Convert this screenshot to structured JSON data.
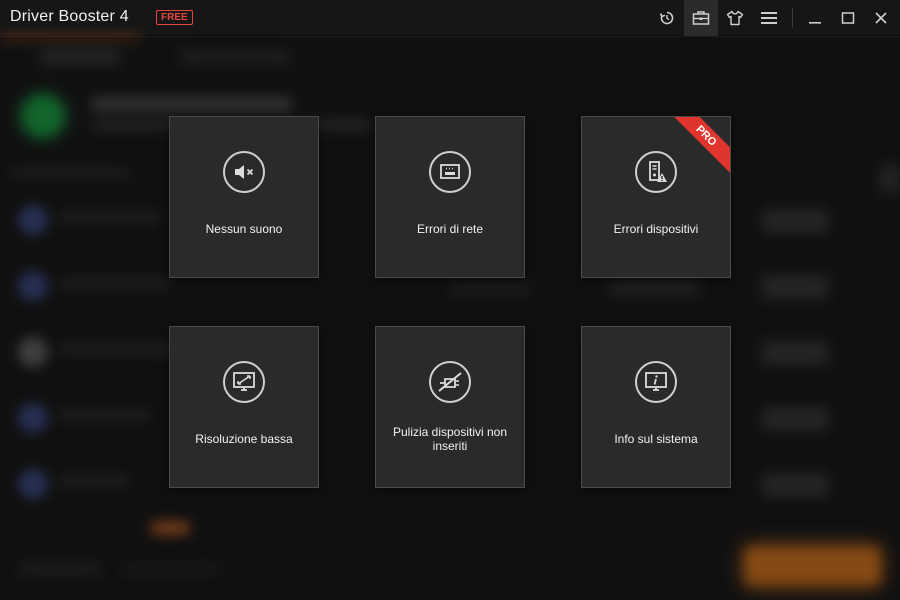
{
  "window": {
    "title": "Driver Booster 4",
    "badge": "FREE",
    "buttons": [
      {
        "name": "restore-icon"
      },
      {
        "name": "toolbox-icon"
      },
      {
        "name": "shirt-icon"
      },
      {
        "name": "menu-icon"
      },
      {
        "name": "minimize-icon"
      },
      {
        "name": "maximize-icon"
      },
      {
        "name": "close-icon"
      }
    ]
  },
  "tools": [
    {
      "label": "Nessun suono",
      "icon": "mute-speaker-icon"
    },
    {
      "label": "Errori di rete",
      "icon": "network-port-icon"
    },
    {
      "label": "Errori dispositivi",
      "icon": "device-warning-icon",
      "badge": "PRO"
    },
    {
      "label": "Risoluzione bassa",
      "icon": "monitor-resize-icon"
    },
    {
      "label": "Pulizia dispositivi non inseriti",
      "icon": "no-device-icon"
    },
    {
      "label": "Info sul sistema",
      "icon": "monitor-info-icon"
    }
  ],
  "colors": {
    "accent": "#e2453b",
    "pro_ribbon": "#e0342f",
    "tile_bg": "#2a2a2a",
    "status_ok": "#1fa84a",
    "orange": "#e07a20"
  }
}
